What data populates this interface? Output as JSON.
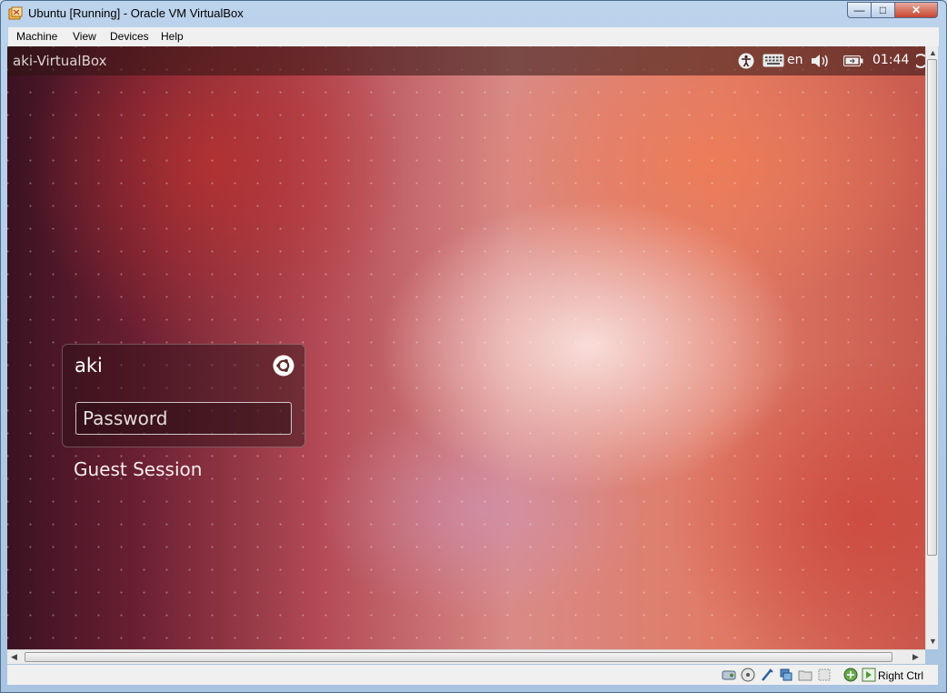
{
  "window": {
    "title": "Ubuntu [Running] - Oracle VM VirtualBox",
    "minimize_label": "—",
    "maximize_label": "□",
    "close_label": "✕"
  },
  "menubar": {
    "items": [
      {
        "label": "Machine"
      },
      {
        "label": "View"
      },
      {
        "label": "Devices"
      },
      {
        "label": "Help"
      }
    ]
  },
  "guest_panel": {
    "hostname": "aki-VirtualBox",
    "keyboard_layout": "en",
    "clock": "01:44",
    "indicator_icons": [
      "accessibility-icon",
      "keyboard-icon",
      "volume-icon",
      "battery-icon",
      "power-icon"
    ]
  },
  "login": {
    "username": "aki",
    "password_placeholder": "Password",
    "session_icon": "ubuntu-session-icon",
    "guest_session_label": "Guest Session"
  },
  "statusbar": {
    "host_key": "Right Ctrl",
    "icons": [
      "hard-disk-icon",
      "optical-drive-icon",
      "usb-icon",
      "shared-folders-icon",
      "display-icon",
      "capture-icon",
      "network-icon",
      "mouse-integration-icon"
    ]
  },
  "colors": {
    "wallpaper_accent": "#d9776a",
    "window_frame": "#bcd3ec",
    "close_button": "#c7452e"
  }
}
